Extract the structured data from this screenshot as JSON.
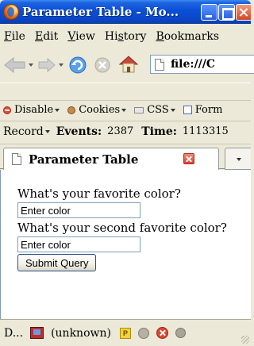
{
  "window": {
    "title": "Parameter Table - Mo..."
  },
  "menu": {
    "items": [
      {
        "pre": "",
        "u": "F",
        "post": "ile"
      },
      {
        "pre": "",
        "u": "E",
        "post": "dit"
      },
      {
        "pre": "",
        "u": "V",
        "post": "iew"
      },
      {
        "pre": "Hi",
        "u": "s",
        "post": "tory"
      },
      {
        "pre": "",
        "u": "B",
        "post": "ookmarks"
      }
    ]
  },
  "navigation": {
    "url": "file:///C"
  },
  "dev_toolbar": {
    "disable_label": "Disable",
    "cookies_label": "Cookies",
    "css_label": "CSS",
    "forms_label": "Form"
  },
  "record_bar": {
    "record_label": "Record",
    "events_label": "Events:",
    "events_value": "2387",
    "time_label": "Time:",
    "time_value": "1113315"
  },
  "tabs": {
    "active_label": "Parameter Table"
  },
  "page": {
    "question1": "What's your favorite color?",
    "field1_value": "Enter color",
    "question2": "What's your second favorite color?",
    "field2_value": "Enter color",
    "submit_label": "Submit Query"
  },
  "status": {
    "left_text": "D...",
    "zone_text": "(unknown)",
    "p_icon_text": "P"
  },
  "colors": {
    "titlebar_blue": "#0b4fd6",
    "chrome_beige": "#ece9d8",
    "field_border": "#7f9db9"
  },
  "icons": [
    "firefox-logo-icon",
    "back-arrow-icon",
    "forward-arrow-icon",
    "reload-icon",
    "stop-icon",
    "home-icon",
    "page-icon",
    "disable-icon",
    "cookies-icon",
    "css-icon",
    "forms-icon",
    "close-tab-icon",
    "tab-list-icon",
    "book-icon",
    "p-icon",
    "status-circle-icon",
    "error-icon",
    "slash-icon",
    "resize-grip-icon"
  ]
}
